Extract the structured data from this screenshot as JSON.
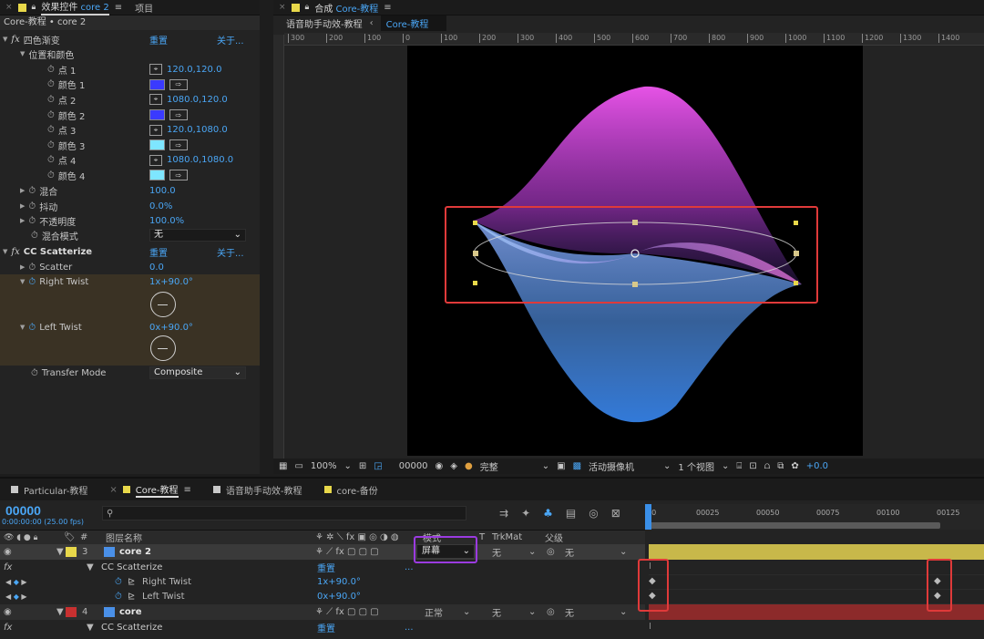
{
  "effect_controls": {
    "tab_title": "效果控件",
    "tab_layer": "core 2",
    "tab_menu_icon": "≡",
    "tab_project": "项目",
    "subheader": "Core-教程 • core 2",
    "reset": "重置",
    "about": "关于...",
    "effect1": {
      "name": "四色渐变",
      "group": "位置和颜色",
      "rows": [
        {
          "label": "点 1",
          "kind": "point",
          "value": "120.0,120.0"
        },
        {
          "label": "颜色 1",
          "kind": "color",
          "color": "#3a3aff"
        },
        {
          "label": "点 2",
          "kind": "point",
          "value": "1080.0,120.0"
        },
        {
          "label": "颜色 2",
          "kind": "color",
          "color": "#3a3aff"
        },
        {
          "label": "点 3",
          "kind": "point",
          "value": "120.0,1080.0"
        },
        {
          "label": "颜色 3",
          "kind": "color",
          "color": "#7ee6ff"
        },
        {
          "label": "点 4",
          "kind": "point",
          "value": "1080.0,1080.0"
        },
        {
          "label": "颜色 4",
          "kind": "color",
          "color": "#7ee6ff"
        }
      ],
      "blend_label": "混合",
      "blend_value": "100.0",
      "jitter_label": "抖动",
      "jitter_value": "0.0%",
      "opacity_label": "不透明度",
      "opacity_value": "100.0%",
      "mode_label": "混合模式",
      "mode_value": "无"
    },
    "effect2": {
      "name": "CC Scatterize",
      "scatter_label": "Scatter",
      "scatter_value": "0.0",
      "right_twist_label": "Right Twist",
      "right_twist_value": "1x+90.0°",
      "left_twist_label": "Left Twist",
      "left_twist_value": "0x+90.0°",
      "transfer_label": "Transfer Mode",
      "transfer_value": "Composite"
    }
  },
  "composition": {
    "tab_title": "合成",
    "tab_name": "Core-教程",
    "breadcrumb_parent": "语音助手动效-教程",
    "breadcrumb_current": "Core-教程",
    "ruler_ticks": [
      "300",
      "200",
      "100",
      "0",
      "100",
      "200",
      "300",
      "400",
      "500",
      "600",
      "700",
      "800",
      "900",
      "1000",
      "1100",
      "1200",
      "1300",
      "1400"
    ],
    "zoom": "100%",
    "timecode": "00000",
    "quality": "完整",
    "camera": "活动摄像机",
    "views": "1 个视图",
    "exposure": "+0.0"
  },
  "timeline": {
    "tabs": [
      "Particular-教程",
      "Core-教程",
      "语音助手动效-教程",
      "core-备份"
    ],
    "tab_colors": [
      "#c8c8c8",
      "#e8d84a",
      "#c8c8c8",
      "#e8d84a"
    ],
    "active_tab_index": 1,
    "timecode": "00000",
    "timecode_sub": "0:00:00:00 (25.00 fps)",
    "search_placeholder": "",
    "col_hash": "#",
    "col_layer_name": "图层名称",
    "col_mode": "模式",
    "col_t": "T",
    "col_trkmat": "TrkMat",
    "col_parent": "父级",
    "ruler_labels": [
      "00",
      "00025",
      "00050",
      "00075",
      "00100",
      "00125"
    ],
    "layers": [
      {
        "num": "3",
        "name": "core 2",
        "color": "#e8d84a",
        "mode": "屏幕",
        "trkmat": "无",
        "parent": "无",
        "effect": "CC Scatterize",
        "reset": "重置",
        "props": [
          {
            "name": "Right Twist",
            "value": "1x+90.0°"
          },
          {
            "name": "Left Twist",
            "value": "0x+90.0°"
          }
        ]
      },
      {
        "num": "4",
        "name": "core",
        "color": "#c83030",
        "mode": "正常",
        "trkmat": "无",
        "parent": "无",
        "effect": "CC Scatterize",
        "reset": "重置"
      }
    ]
  }
}
